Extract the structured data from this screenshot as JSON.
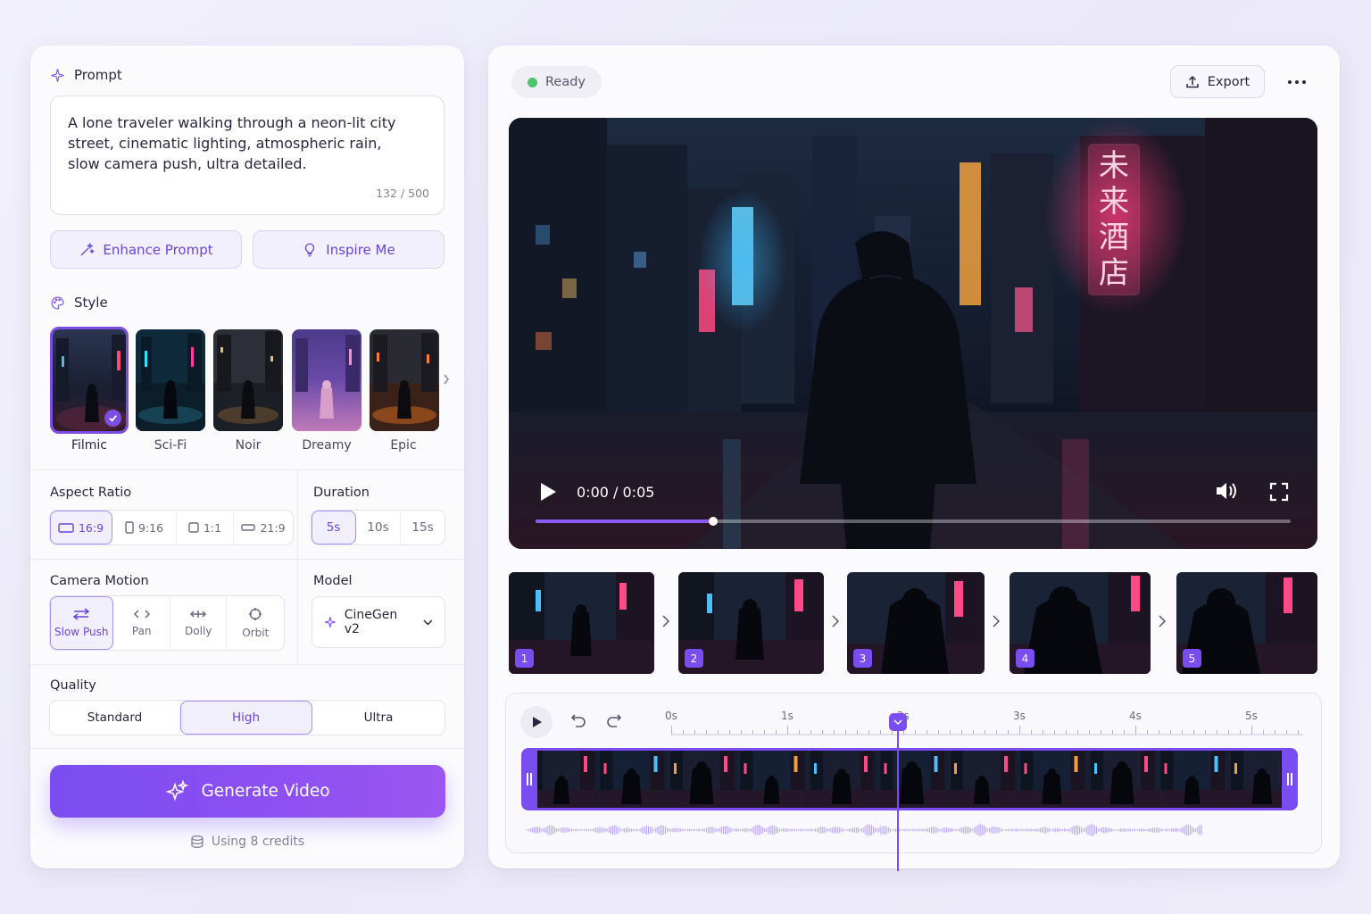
{
  "prompt": {
    "title": "Prompt",
    "text": "A lone traveler walking through a neon-lit city street, cinematic lighting, atmospheric rain, slow camera push, ultra detailed.",
    "counter": "132 / 500",
    "enhance_label": "Enhance Prompt",
    "inspire_label": "Inspire Me"
  },
  "style": {
    "title": "Style",
    "options": [
      {
        "label": "Filmic",
        "selected": true
      },
      {
        "label": "Sci-Fi",
        "selected": false
      },
      {
        "label": "Noir",
        "selected": false
      },
      {
        "label": "Dreamy",
        "selected": false
      },
      {
        "label": "Epic",
        "selected": false
      }
    ]
  },
  "aspect_ratio": {
    "title": "Aspect Ratio",
    "options": [
      "16:9",
      "9:16",
      "1:1",
      "21:9"
    ],
    "selected": "16:9"
  },
  "duration": {
    "title": "Duration",
    "options": [
      "5s",
      "10s",
      "15s"
    ],
    "selected": "5s"
  },
  "camera_motion": {
    "title": "Camera Motion",
    "options": [
      "Slow Push",
      "Pan",
      "Dolly",
      "Orbit"
    ],
    "selected": "Slow Push"
  },
  "model": {
    "title": "Model",
    "value": "CineGen v2"
  },
  "quality": {
    "title": "Quality",
    "options": [
      "Standard",
      "High",
      "Ultra"
    ],
    "selected": "High"
  },
  "generate": {
    "label": "Generate Video",
    "credits": "Using 8 credits"
  },
  "header": {
    "status": "Ready",
    "export_label": "Export"
  },
  "player": {
    "time": "0:00 / 0:05",
    "progress": 0.235,
    "sign_text": "未来酒店"
  },
  "frames": [
    "1",
    "2",
    "3",
    "4",
    "5"
  ],
  "timeline": {
    "ticks": [
      "0s",
      "1s",
      "2s",
      "3s",
      "4s",
      "5s"
    ],
    "playhead_seconds": 1.95
  },
  "colors": {
    "accent": "#7a4df0",
    "status_ready": "#4dc46a"
  }
}
